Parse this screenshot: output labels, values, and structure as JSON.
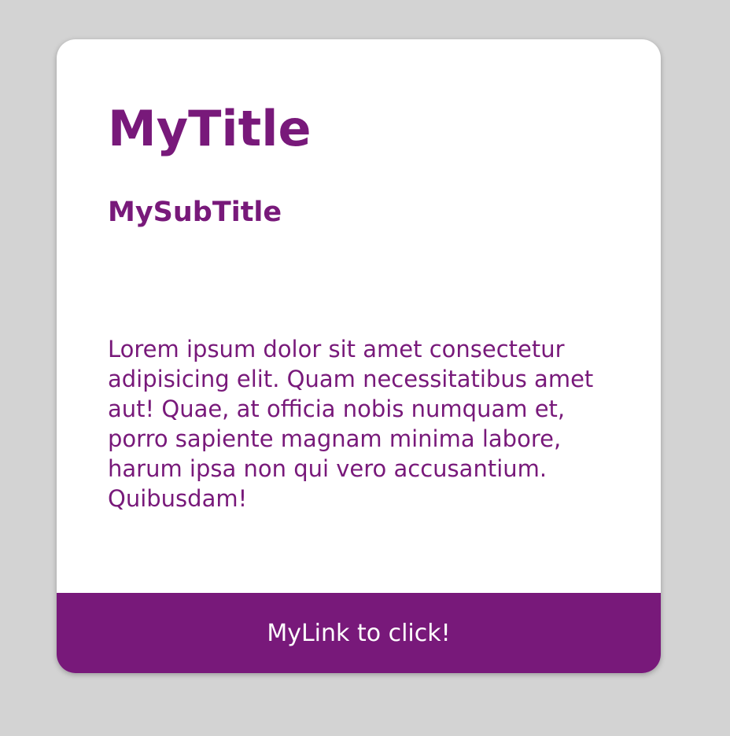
{
  "colors": {
    "background": "#d3d3d3",
    "card": "#ffffff",
    "accent": "#78197a",
    "link_text": "#ffffff"
  },
  "card": {
    "title": "MyTitle",
    "subtitle": "MySubTitle",
    "text": "Lorem ipsum dolor sit amet consectetur adipisicing elit. Quam necessitatibus amet aut! Quae, at officia nobis numquam et, porro sapiente magnam minima labore, harum ipsa non qui vero accusantium. Quibusdam!",
    "link_label": "MyLink to click!"
  }
}
